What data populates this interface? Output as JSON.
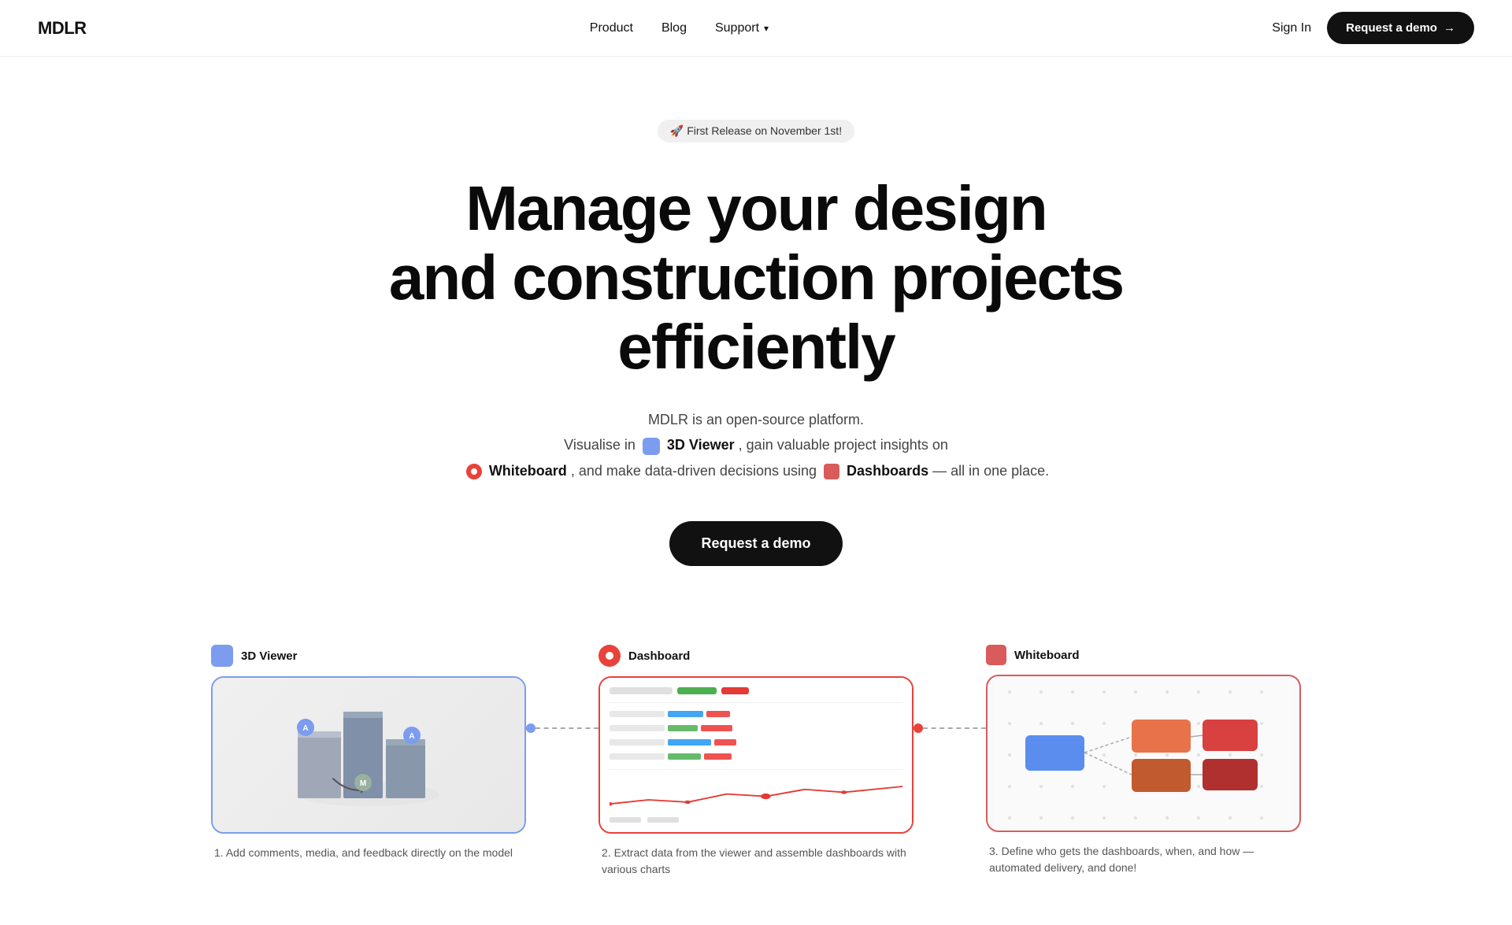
{
  "brand": {
    "logo": "MDLR"
  },
  "nav": {
    "links": [
      {
        "label": "Product",
        "id": "product"
      },
      {
        "label": "Blog",
        "id": "blog"
      },
      {
        "label": "Support",
        "id": "support",
        "has_dropdown": true
      }
    ],
    "signin": "Sign In",
    "demo_cta": "Request a demo",
    "demo_arrow": "→"
  },
  "hero": {
    "badge": "🚀 First Release on November 1st!",
    "headline_line1": "Manage your design",
    "headline_line2": "and construction projects",
    "headline_line3": "efficiently",
    "desc_line1": "MDLR is an open-source platform.",
    "desc_line2_pre": "Visualise in",
    "desc_line2_viewer": "3D Viewer",
    "desc_line2_post": ", gain valuable project insights on",
    "desc_line3_wb": "Whiteboard",
    "desc_line3_post": ", and make data-driven decisions using",
    "desc_line4_dash": "Dashboards",
    "desc_line4_post": "— all in one place.",
    "cta": "Request a demo"
  },
  "features": [
    {
      "id": "3d-viewer",
      "label": "3D Viewer",
      "caption_num": "1.",
      "caption": "Add comments, media, and feedback directly on the model"
    },
    {
      "id": "dashboard",
      "label": "Dashboard",
      "caption_num": "2.",
      "caption": "Extract data from the viewer and assemble dashboards with various charts"
    },
    {
      "id": "whiteboard",
      "label": "Whiteboard",
      "caption_num": "3.",
      "caption": "Define who gets the dashboards, when, and how — automated delivery, and done!"
    }
  ],
  "colors": {
    "accent_blue": "#7b9cef",
    "accent_red": "#e8423a",
    "accent_wb": "#d95b5b",
    "dark": "#111111",
    "badge_bg": "#efefef"
  }
}
